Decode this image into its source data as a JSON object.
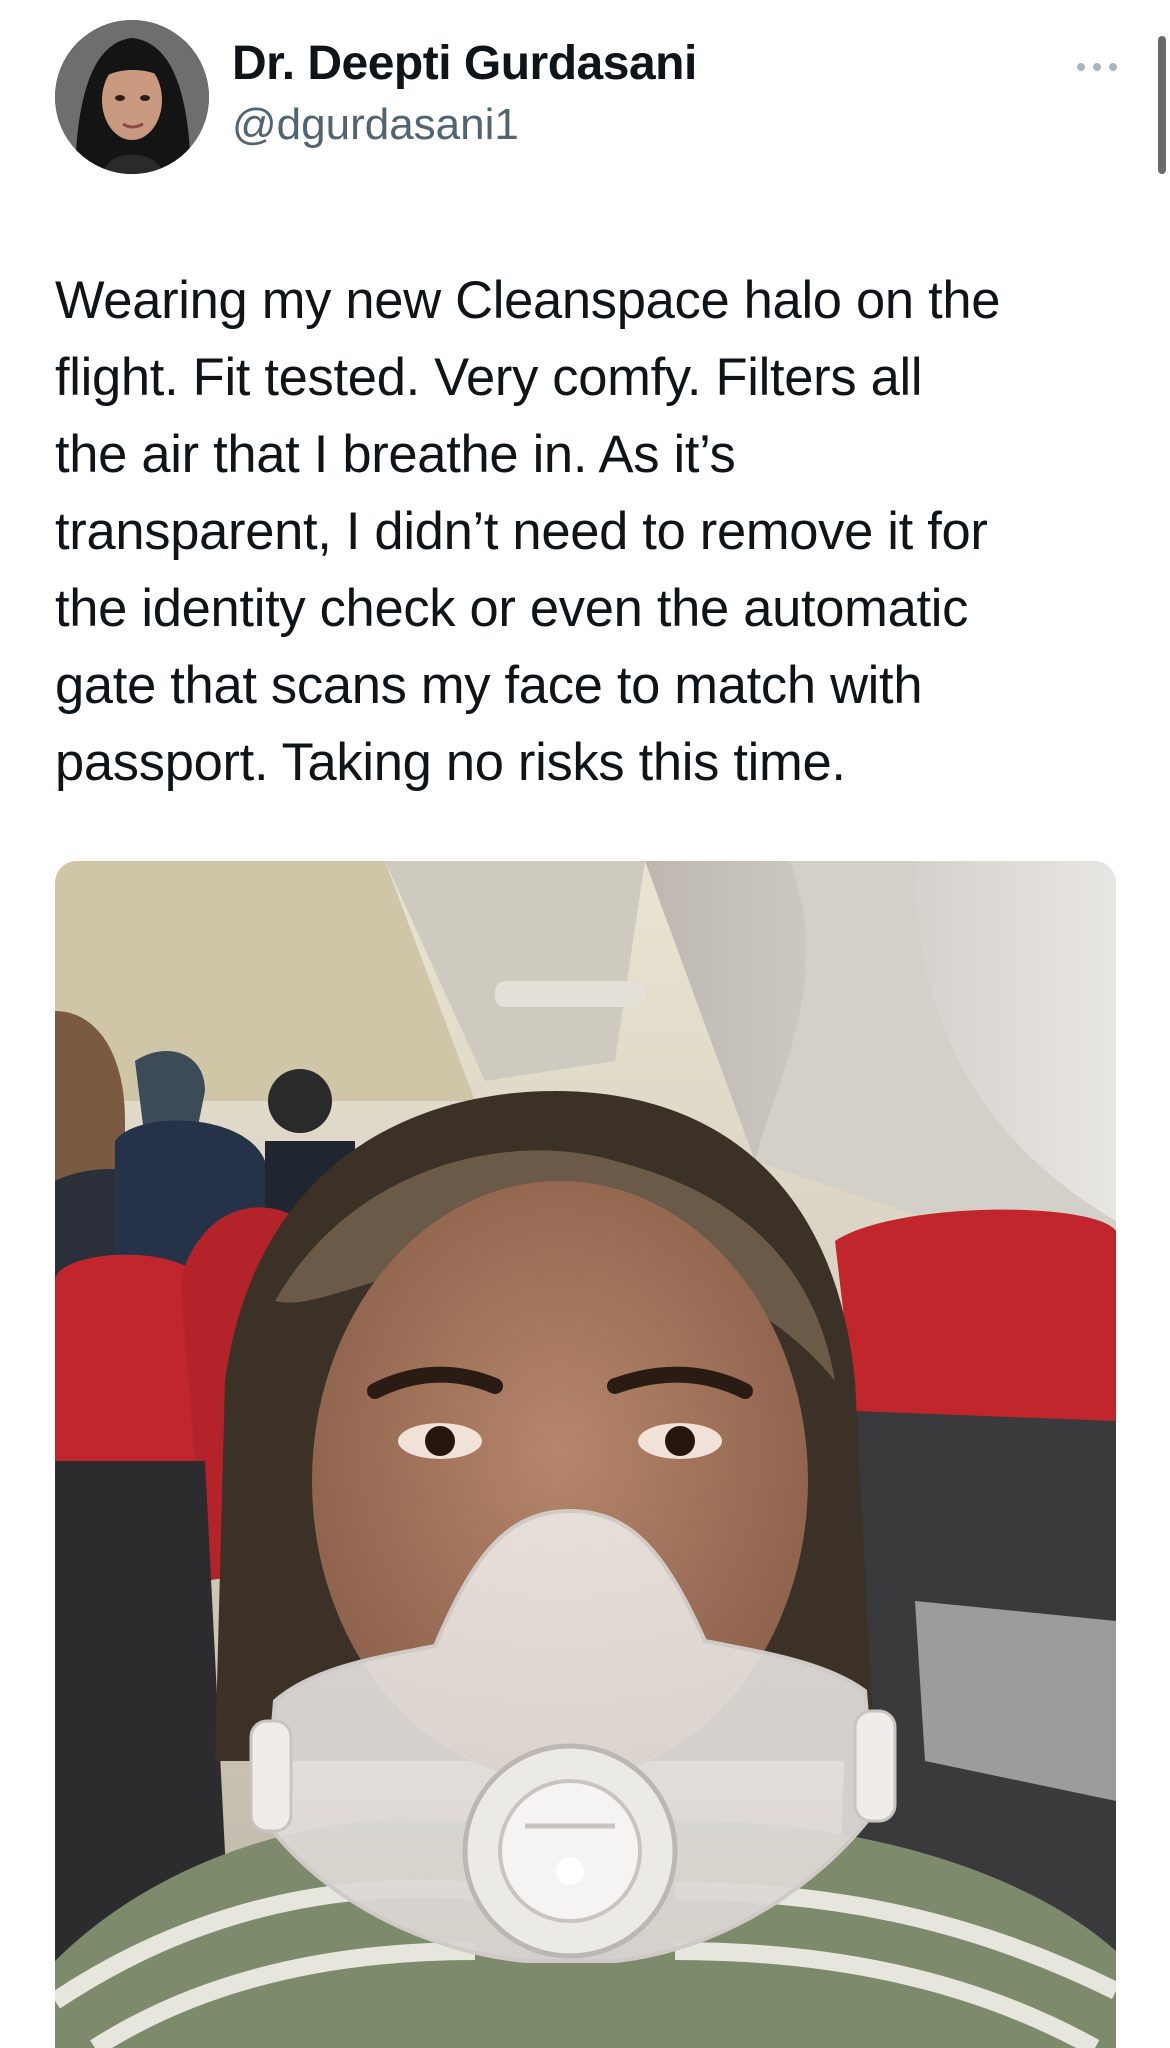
{
  "tweet": {
    "author": {
      "display_name": "Dr. Deepti Gurdasani",
      "handle": "@dgurdasani1",
      "avatar_icon": "profile-photo"
    },
    "more_icon": "more-horizontal-icon",
    "text": "Wearing my new Cleanspace halo on the\nflight. Fit tested. Very comfy. Filters all\nthe air that I breathe in. As it’s\ntransparent, I didn’t need to remove it for\nthe identity check or even the automatic\ngate that scans my face to match with\npassport. Taking no risks this time.",
    "media": {
      "kind": "photo"
    }
  },
  "colors": {
    "text": "#0f1419",
    "secondary": "#536471",
    "seat_red": "#c0262c"
  }
}
